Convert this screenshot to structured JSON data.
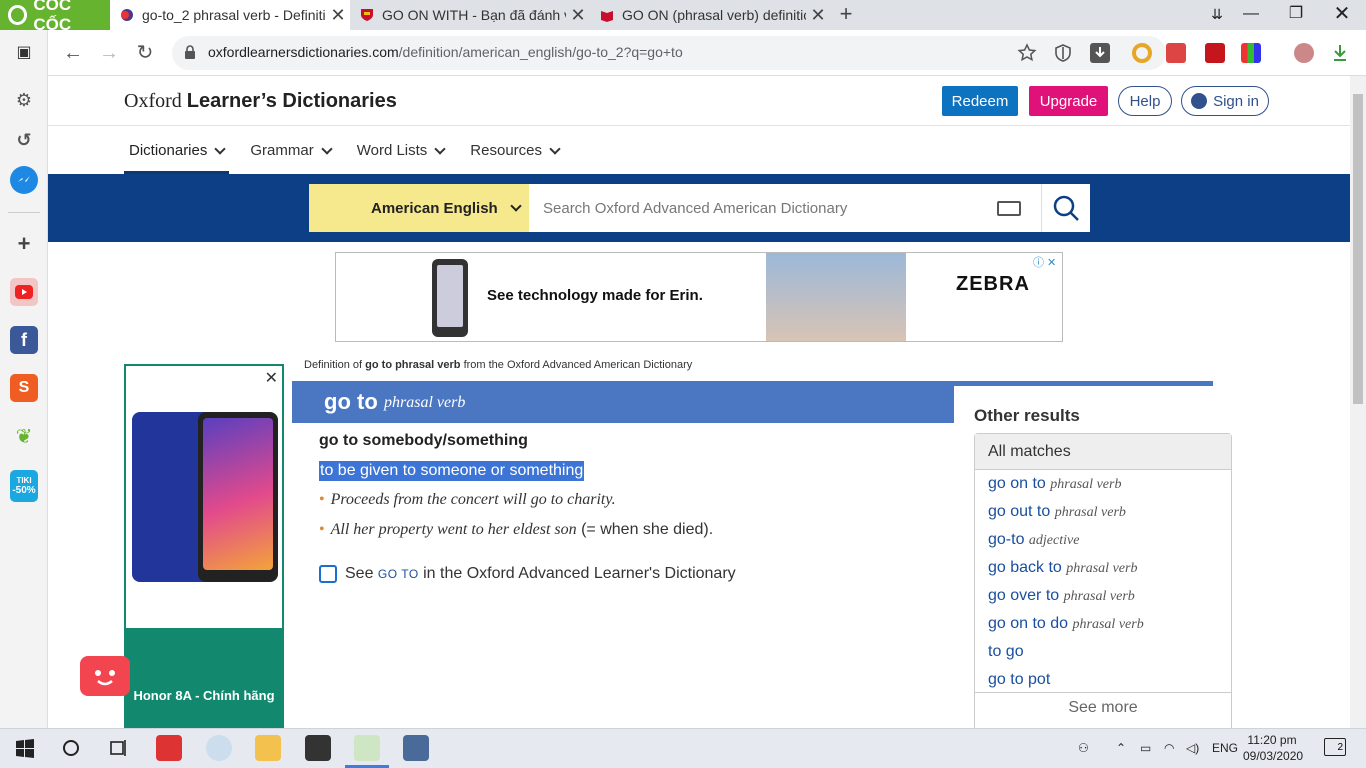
{
  "browser": {
    "brand": "CỐC CỐC",
    "tabs": [
      {
        "title": "go-to_2 phrasal verb - Definiti",
        "active": true
      },
      {
        "title": "GO ON WITH - Bạn đã đánh v",
        "active": false
      },
      {
        "title": "GO ON (phrasal verb) definitio",
        "active": false
      }
    ],
    "url_domain": "oxfordlearnersdictionaries.com",
    "url_path": "/definition/american_english/go-to_2?q=go+to"
  },
  "header": {
    "site_title_plain": "Oxford ",
    "site_title_bold": "Learner’s Dictionaries",
    "redeem": "Redeem",
    "upgrade": "Upgrade",
    "help": "Help",
    "signin": "Sign in"
  },
  "nav": {
    "items": [
      "Dictionaries",
      "Grammar",
      "Word Lists",
      "Resources"
    ]
  },
  "search": {
    "dictionary": "American English",
    "placeholder": "Search Oxford Advanced American Dictionary"
  },
  "ads": {
    "banner_text": "See technology made for Erin.",
    "banner_brand": "ZEBRA",
    "side_caption": "Honor 8A - Chính hãng"
  },
  "entry": {
    "crumb_pre": "Definition of ",
    "crumb_bold": "go to phrasal verb",
    "crumb_post": " from the Oxford Advanced American Dictionary",
    "headword": "go to",
    "pos": "phrasal verb",
    "sense_head": "go to somebody/something",
    "definition": "to be given to someone or something",
    "examples": [
      {
        "text": "Proceeds from the concert will go to charity.",
        "note": ""
      },
      {
        "text": "All her property went to her eldest son",
        "note": " (= when she died)."
      }
    ],
    "see_pre": "See ",
    "see_link": "GO TO",
    "see_post": " in the Oxford Advanced Learner's Dictionary"
  },
  "other_results": {
    "heading": "Other results",
    "tab": "All matches",
    "items": [
      {
        "word": "go on to",
        "pos": "phrasal verb"
      },
      {
        "word": "go out to",
        "pos": "phrasal verb"
      },
      {
        "word": "go-to",
        "pos": "adjective"
      },
      {
        "word": "go back to",
        "pos": "phrasal verb"
      },
      {
        "word": "go over to",
        "pos": "phrasal verb"
      },
      {
        "word": "go on to do",
        "pos": "phrasal verb"
      },
      {
        "word": "to go",
        "pos": ""
      },
      {
        "word": "go to pot",
        "pos": ""
      }
    ],
    "see_more": "See more"
  },
  "taskbar": {
    "lang": "ENG",
    "time": "11:20 pm",
    "date": "09/03/2020",
    "notifications": "2"
  },
  "sidebar": {
    "tiki_label": "TIKI",
    "tiki_discount": "-50%"
  },
  "colors": {
    "oxford_blue": "#0d3f86",
    "entry_blue": "#4a76c2",
    "redeem": "#0d72c0",
    "upgrade": "#e0127a",
    "selector_yellow": "#f5e88d",
    "ad_green": "#12896f"
  }
}
